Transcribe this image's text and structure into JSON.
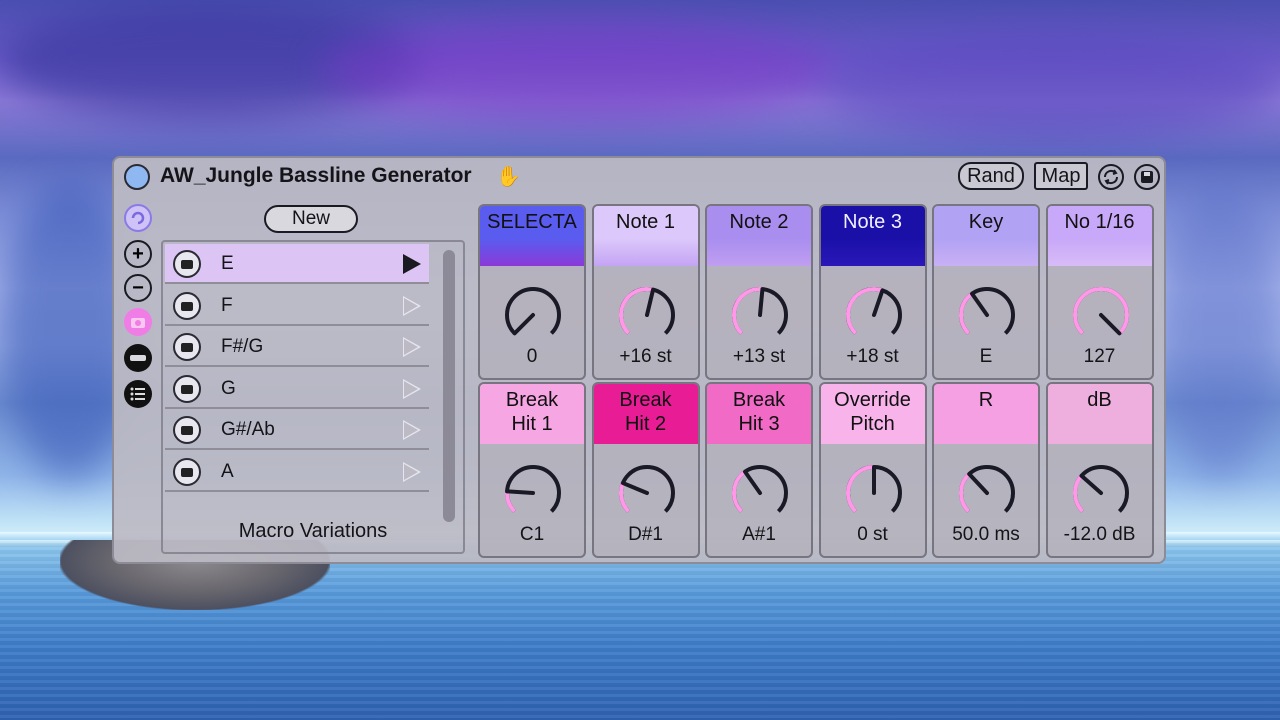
{
  "device": {
    "title": "AW_Jungle Bassline Generator",
    "rand_label": "Rand",
    "map_label": "Map"
  },
  "variations": {
    "new_label": "New",
    "title": "Macro Variations",
    "items": [
      {
        "label": "E",
        "active": true
      },
      {
        "label": "F",
        "active": false
      },
      {
        "label": "F#/G",
        "active": false
      },
      {
        "label": "G",
        "active": false
      },
      {
        "label": "G#/Ab",
        "active": false
      },
      {
        "label": "A",
        "active": false
      }
    ]
  },
  "macros": [
    {
      "label": "SELECTA",
      "value": "0",
      "level": 0.0,
      "top": "#5a5cf0",
      "bottom": "#8a3ad8",
      "light": false
    },
    {
      "label": "Note 1",
      "value": "+16 st",
      "level": 0.55,
      "top": "#dcc8fa",
      "bottom": "#c4a4f4",
      "light": false
    },
    {
      "label": "Note 2",
      "value": "+13 st",
      "level": 0.52,
      "top": "#a98ef0",
      "bottom": "#c09ef0",
      "light": false
    },
    {
      "label": "Note 3",
      "value": "+18 st",
      "level": 0.57,
      "top": "#1a10a8",
      "bottom": "#2a18b8",
      "light": true
    },
    {
      "label": "Key",
      "value": "E",
      "level": 0.37,
      "top": "#b2a2f4",
      "bottom": "#c8b0f4",
      "light": false
    },
    {
      "label": "No 1/16",
      "value": "127",
      "level": 1.0,
      "top": "#c8a8f8",
      "bottom": "#d8bcf8",
      "light": false
    },
    {
      "label": "Break\nHit 1",
      "value": "C1",
      "level": 0.18,
      "top": "#f6a6e2",
      "bottom": "#f6a6e2",
      "light": false
    },
    {
      "label": "Break\nHit 2",
      "value": "D#1",
      "level": 0.25,
      "top": "#e81c94",
      "bottom": "#e81c94",
      "light": false
    },
    {
      "label": "Break\nHit 3",
      "value": "A#1",
      "level": 0.37,
      "top": "#f06ac6",
      "bottom": "#f06ac6",
      "light": false
    },
    {
      "label": "Override\nPitch",
      "value": "0 st",
      "level": 0.5,
      "top": "#f8b4ea",
      "bottom": "#f8b4ea",
      "light": false
    },
    {
      "label": "R",
      "value": "50.0 ms",
      "level": 0.34,
      "top": "#f4a0e2",
      "bottom": "#f4a0e2",
      "light": false
    },
    {
      "label": "dB",
      "value": "-12.0 dB",
      "level": 0.32,
      "top": "#eeaede",
      "bottom": "#eeaede",
      "light": false
    }
  ],
  "colors": {
    "knob_track": "#ff98e8",
    "knob_outline": "#1a1a26"
  }
}
